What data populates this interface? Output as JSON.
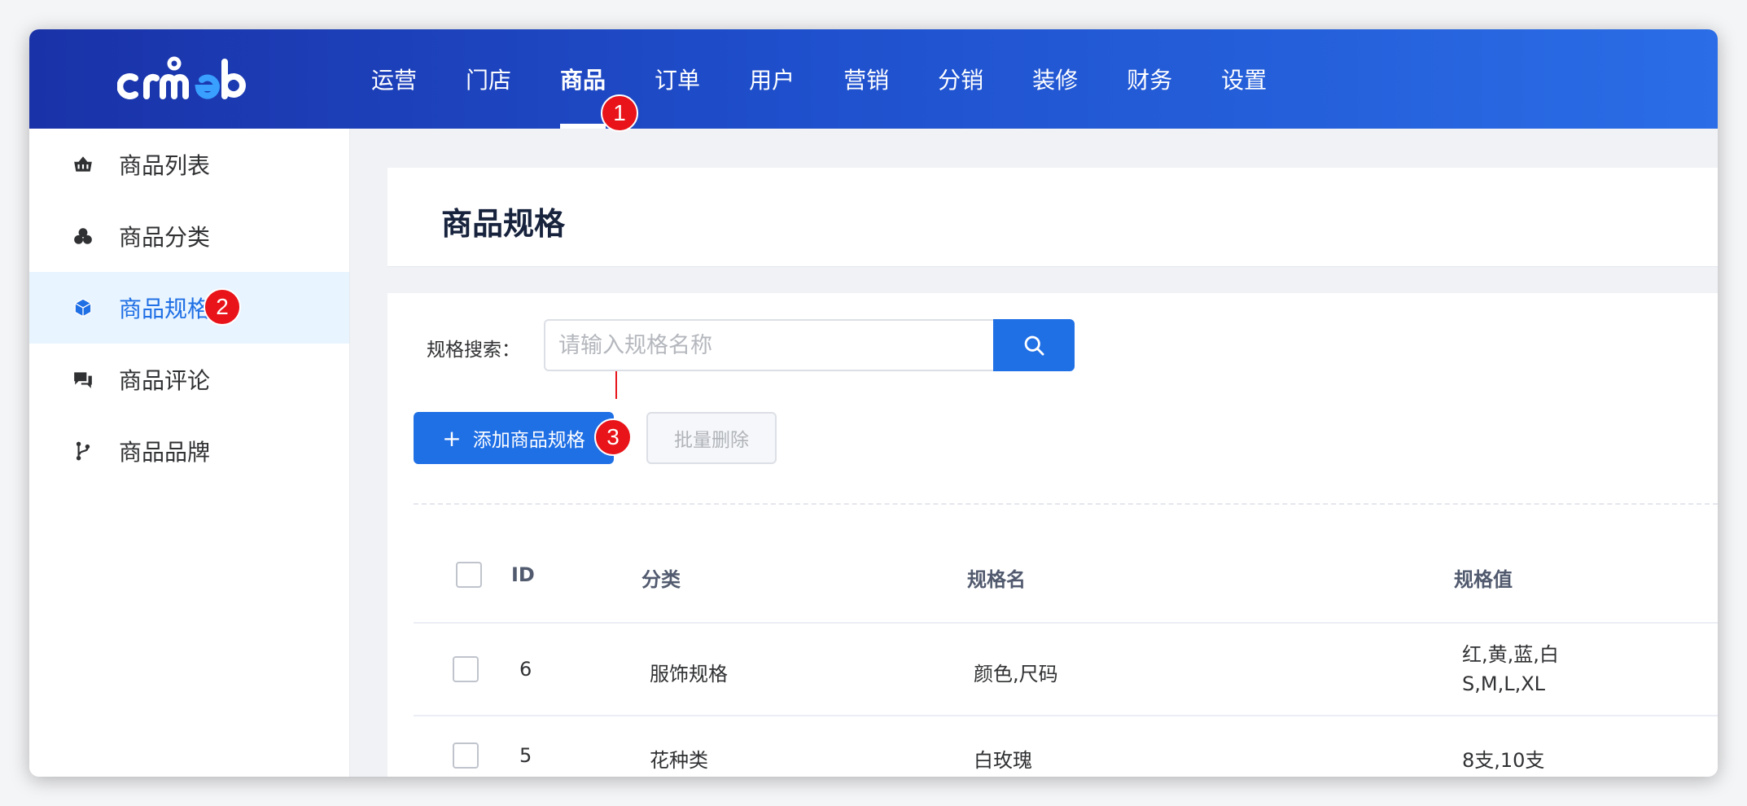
{
  "app": {
    "logo_text": "crmeb",
    "accent_color": "#1f6fe5",
    "marker_color": "#e8141a"
  },
  "topnav": {
    "items": [
      {
        "label": "运营"
      },
      {
        "label": "门店"
      },
      {
        "label": "商品",
        "active": true
      },
      {
        "label": "订单"
      },
      {
        "label": "用户"
      },
      {
        "label": "营销"
      },
      {
        "label": "分销"
      },
      {
        "label": "装修"
      },
      {
        "label": "财务"
      },
      {
        "label": "设置"
      }
    ]
  },
  "sidebar": {
    "items": [
      {
        "label": "商品列表",
        "icon": "basket-icon"
      },
      {
        "label": "商品分类",
        "icon": "cluster-icon"
      },
      {
        "label": "商品规格",
        "icon": "cube-icon",
        "active": true
      },
      {
        "label": "商品评论",
        "icon": "comments-icon"
      },
      {
        "label": "商品品牌",
        "icon": "branch-icon"
      }
    ]
  },
  "markers": [
    "1",
    "2",
    "3"
  ],
  "page": {
    "title": "商品规格"
  },
  "search": {
    "label": "规格搜索：",
    "placeholder": "请输入规格名称",
    "value": "",
    "button_icon": "search-icon"
  },
  "actions": {
    "add_label": "添加商品规格",
    "add_icon": "plus-icon",
    "batch_delete_label": "批量删除"
  },
  "table": {
    "columns": [
      "ID",
      "分类",
      "规格名",
      "规格值"
    ],
    "rows": [
      {
        "id": "6",
        "category": "服饰规格",
        "name": "颜色,尺码",
        "values": [
          "红,黄,蓝,白",
          "S,M,L,XL"
        ]
      },
      {
        "id": "5",
        "category": "花种类",
        "name": "白玫瑰",
        "values": [
          "8支,10支"
        ]
      }
    ]
  }
}
